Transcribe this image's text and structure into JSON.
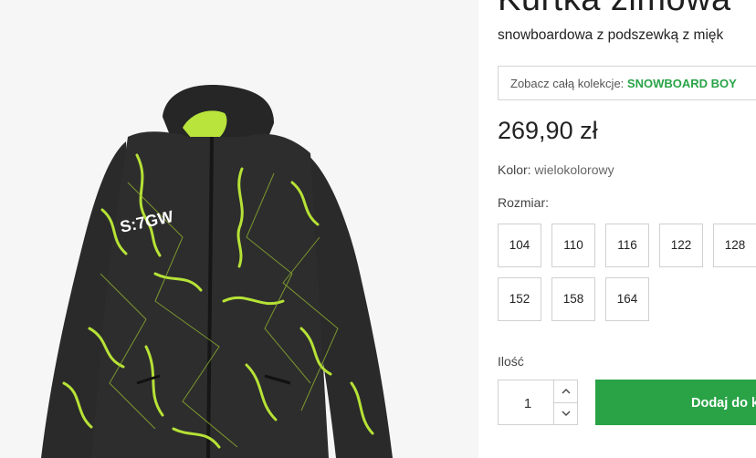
{
  "product": {
    "title": "Kurtka zimowa",
    "subtitle": "snowboardowa z podszewką z mięk",
    "image_alt": "jacket-photo",
    "jacket_print": "S:7GW",
    "collection": {
      "prefix": "Zobacz całą kolekcje:",
      "name": "SNOWBOARD BOY"
    },
    "price": "269,90 zł",
    "color": {
      "label": "Kolor:",
      "value": "wielokolorowy"
    },
    "size_label": "Rozmiar:",
    "sizes": [
      "104",
      "110",
      "116",
      "122",
      "128",
      "152",
      "158",
      "164"
    ],
    "quantity": {
      "label": "Ilość",
      "value": "1"
    },
    "add_to_cart": "Dodaj do k",
    "accent_color": "#2aa347"
  }
}
